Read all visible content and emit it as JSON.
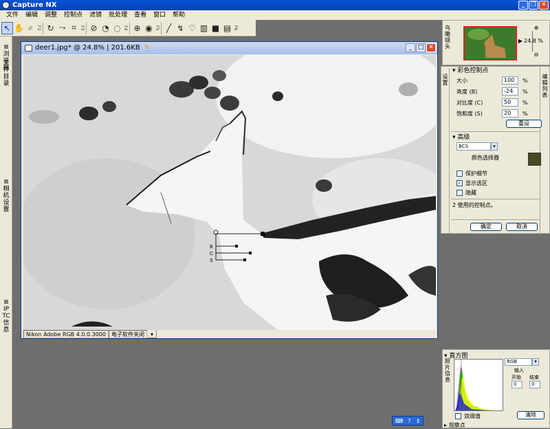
{
  "app": {
    "title": "Capture NX"
  },
  "menu": [
    "文件",
    "编辑",
    "调整",
    "控制点",
    "滤镜",
    "批处理",
    "查看",
    "窗口",
    "帮助"
  ],
  "toolbar": {
    "tools": [
      "select-arrow",
      "hand",
      "zoom",
      "rotate",
      "straighten",
      "crop",
      "color-control-point",
      "black-control-point",
      "white-control-point",
      "red-eye",
      "lasso",
      "brush",
      "gradient",
      "fill"
    ],
    "fkeys": [
      "F2",
      "F3",
      "F4",
      "F5",
      "F6"
    ]
  },
  "left_tabs": [
    "浏览器",
    "文件目录",
    "相机设置",
    "IPTC信息"
  ],
  "document": {
    "title": "deer1.jpg* @ 24.8% | 201.6KB",
    "status_version": "Nikon Adobe RGB 4.0.0.3000",
    "status_note": "电子软件关闭",
    "control_point_labels": [
      "B",
      "C",
      "S"
    ]
  },
  "navigator": {
    "tab": "鸟瞰镜头",
    "zoom": "24.8 %"
  },
  "edit_panel": {
    "settings_tab": "设置",
    "edit_list_tab": "编辑列表",
    "section_title": "彩色控制点",
    "fields": [
      {
        "label": "大小",
        "value": "100",
        "unit": "%"
      },
      {
        "label": "亮度 (B)",
        "value": "-24",
        "unit": "%"
      },
      {
        "label": "对比度 (C)",
        "value": "50",
        "unit": "%"
      },
      {
        "label": "饱和度 (S)",
        "value": "20",
        "unit": "%"
      }
    ],
    "reset_button": "重设",
    "advanced_title": "高级",
    "mode_select": "BCS",
    "color_picker_label": "颜色选择器",
    "swatch_color": "#4a4a24",
    "checkboxes": [
      {
        "label": "保护细节",
        "checked": false
      },
      {
        "label": "显示选区",
        "checked": true
      },
      {
        "label": "隐藏",
        "checked": false
      }
    ],
    "status_text": "2 使用的控制点。",
    "ok_button": "确定",
    "cancel_button": "取消"
  },
  "histogram": {
    "title": "直方图",
    "tab": "照片信息",
    "channel": "RGB",
    "input_label": "输入",
    "start_label": "开始",
    "end_label": "结束",
    "start_value": "0",
    "end_value": "0",
    "threshold_label": "双阈值",
    "clear_button": "清除",
    "watch_points": "观察点"
  }
}
